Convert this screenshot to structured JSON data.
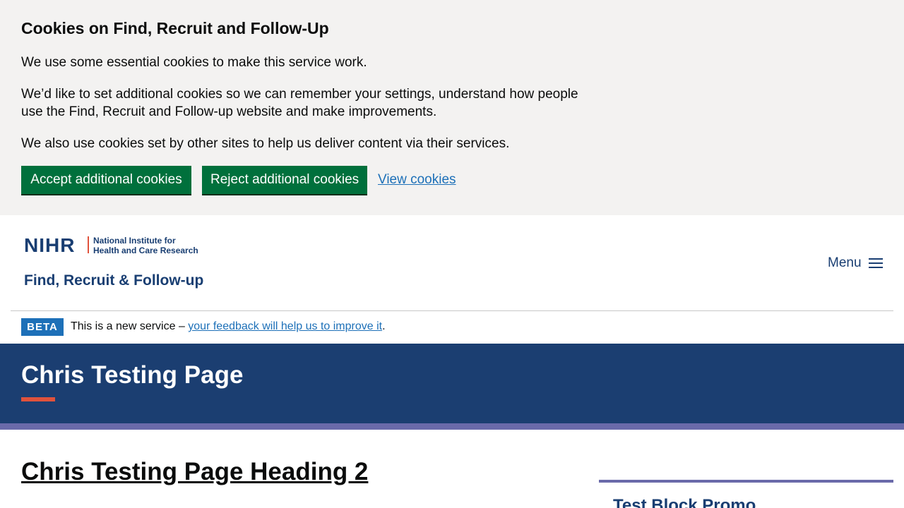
{
  "cookie_banner": {
    "title": "Cookies on Find, Recruit and Follow-Up",
    "paragraph_1": "We use some essential cookies to make this service work.",
    "paragraph_2": "We’d like to set additional cookies so we can remember your settings, understand how people use the Find, Recruit and Follow-up website and make improvements.",
    "paragraph_3": "We also use cookies set by other sites to help us deliver content via their services.",
    "accept_label": "Accept additional cookies",
    "reject_label": "Reject additional cookies",
    "view_label": "View cookies"
  },
  "header": {
    "logo_nihr": "NIHR",
    "logo_institute_line1": "National Institute for",
    "logo_institute_line2": "Health and Care Research",
    "logo_service": "Find, Recruit & Follow-up",
    "menu_label": "Menu"
  },
  "beta": {
    "tag": "BETA",
    "text": "This is a new service – ",
    "link": "your feedback will help us to improve it",
    "suffix": "."
  },
  "hero": {
    "title": "Chris Testing Page"
  },
  "main": {
    "heading": "Chris Testing Page Heading 2",
    "promo_title": "Test Block Promo"
  },
  "colors": {
    "brand_navy": "#1b3e71",
    "accent_red": "#e0523c",
    "stripe_purple": "#6a6aaa",
    "button_green": "#00703c",
    "link_blue": "#1d70b8"
  }
}
